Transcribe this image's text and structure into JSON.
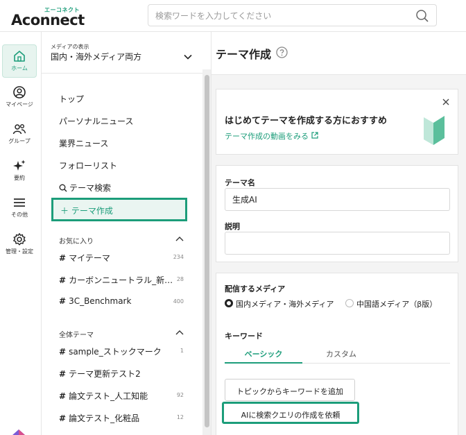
{
  "header": {
    "logo_kana": "エーコネクト",
    "logo_word": "Aconnect",
    "search_placeholder": "検索ワードを入力してください"
  },
  "rail": {
    "items": [
      {
        "label": "ホーム",
        "icon": "home-icon"
      },
      {
        "label": "マイページ",
        "icon": "user-icon"
      },
      {
        "label": "グループ",
        "icon": "group-icon"
      },
      {
        "label": "要約",
        "icon": "sparkle-icon"
      },
      {
        "label": "その他",
        "icon": "menu-icon"
      },
      {
        "label": "管理・設定",
        "icon": "gear-icon"
      }
    ]
  },
  "nav": {
    "media_caption": "メディアの表示",
    "media_value": "国内・海外メディア両方",
    "links": [
      "トップ",
      "パーソナルニュース",
      "業界ニュース",
      "フォローリスト"
    ],
    "theme_search": "テーマ検索",
    "create_theme": "＋ テーマ作成",
    "favorites": {
      "title": "お気に入り",
      "items": [
        {
          "name": "マイテーマ",
          "count": "234"
        },
        {
          "name": "カーボンニュートラル_新…",
          "count": "28"
        },
        {
          "name": "3C_Benchmark",
          "count": "400"
        }
      ]
    },
    "all_themes": {
      "title": "全体テーマ",
      "items": [
        {
          "name": "sample_ストックマーク",
          "count": "1"
        },
        {
          "name": "テーマ更新テスト2",
          "count": ""
        },
        {
          "name": "論文テスト_人工知能",
          "count": "92"
        },
        {
          "name": "論文テスト_化粧品",
          "count": "12"
        }
      ]
    }
  },
  "main": {
    "title": "テーマ作成",
    "promo": {
      "title": "はじめてテーマを作成する方におすすめ",
      "link": "テーマ作成の動画をみる"
    },
    "theme_name_label": "テーマ名",
    "theme_name_value": "生成AI",
    "description_label": "説明",
    "media_label": "配信するメディア",
    "media_options": [
      {
        "label": "国内メディア・海外メディア",
        "selected": true
      },
      {
        "label": "中国語メディア（β版）",
        "selected": false
      }
    ],
    "keyword_label": "キーワード",
    "tabs": [
      {
        "label": "ベーシック",
        "active": true
      },
      {
        "label": "カスタム",
        "active": false
      }
    ],
    "add_from_topic": "トピックからキーワードを追加",
    "ai_query": "AIに検索クエリの作成を依頼"
  },
  "colors": {
    "accent": "#1c9d7a",
    "accent_bg": "#eaf5f1",
    "main_bg": "#f4f4f4"
  }
}
